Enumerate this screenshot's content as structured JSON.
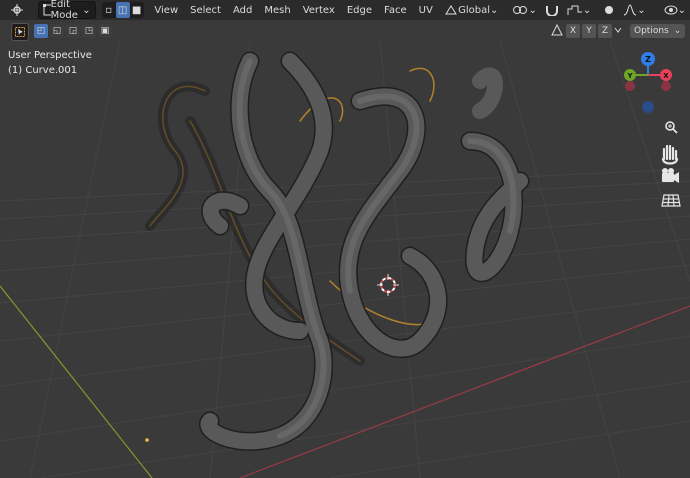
{
  "header": {
    "mode_label": "Edit Mode",
    "menus": [
      "View",
      "Select",
      "Add",
      "Mesh",
      "Vertex",
      "Edge",
      "Face",
      "UV"
    ],
    "orientation_label": "Global"
  },
  "toolbar": {
    "axis_labels": [
      "X",
      "Y",
      "Z"
    ],
    "options_label": "Options"
  },
  "viewport": {
    "perspective_label": "User Perspective",
    "object_label": "(1) Curve.001"
  },
  "gizmo": {
    "z_label": "Z",
    "y_label": "Y",
    "x_label": "X",
    "colors": {
      "x": "#e8415a",
      "y": "#6ea629",
      "z": "#2f7ee8"
    }
  },
  "icons": [
    "select-box-icon",
    "zoom-icon",
    "hand-pan-icon",
    "camera-icon",
    "grid-ortho-icon",
    "overlay-icon",
    "shading-icon"
  ]
}
